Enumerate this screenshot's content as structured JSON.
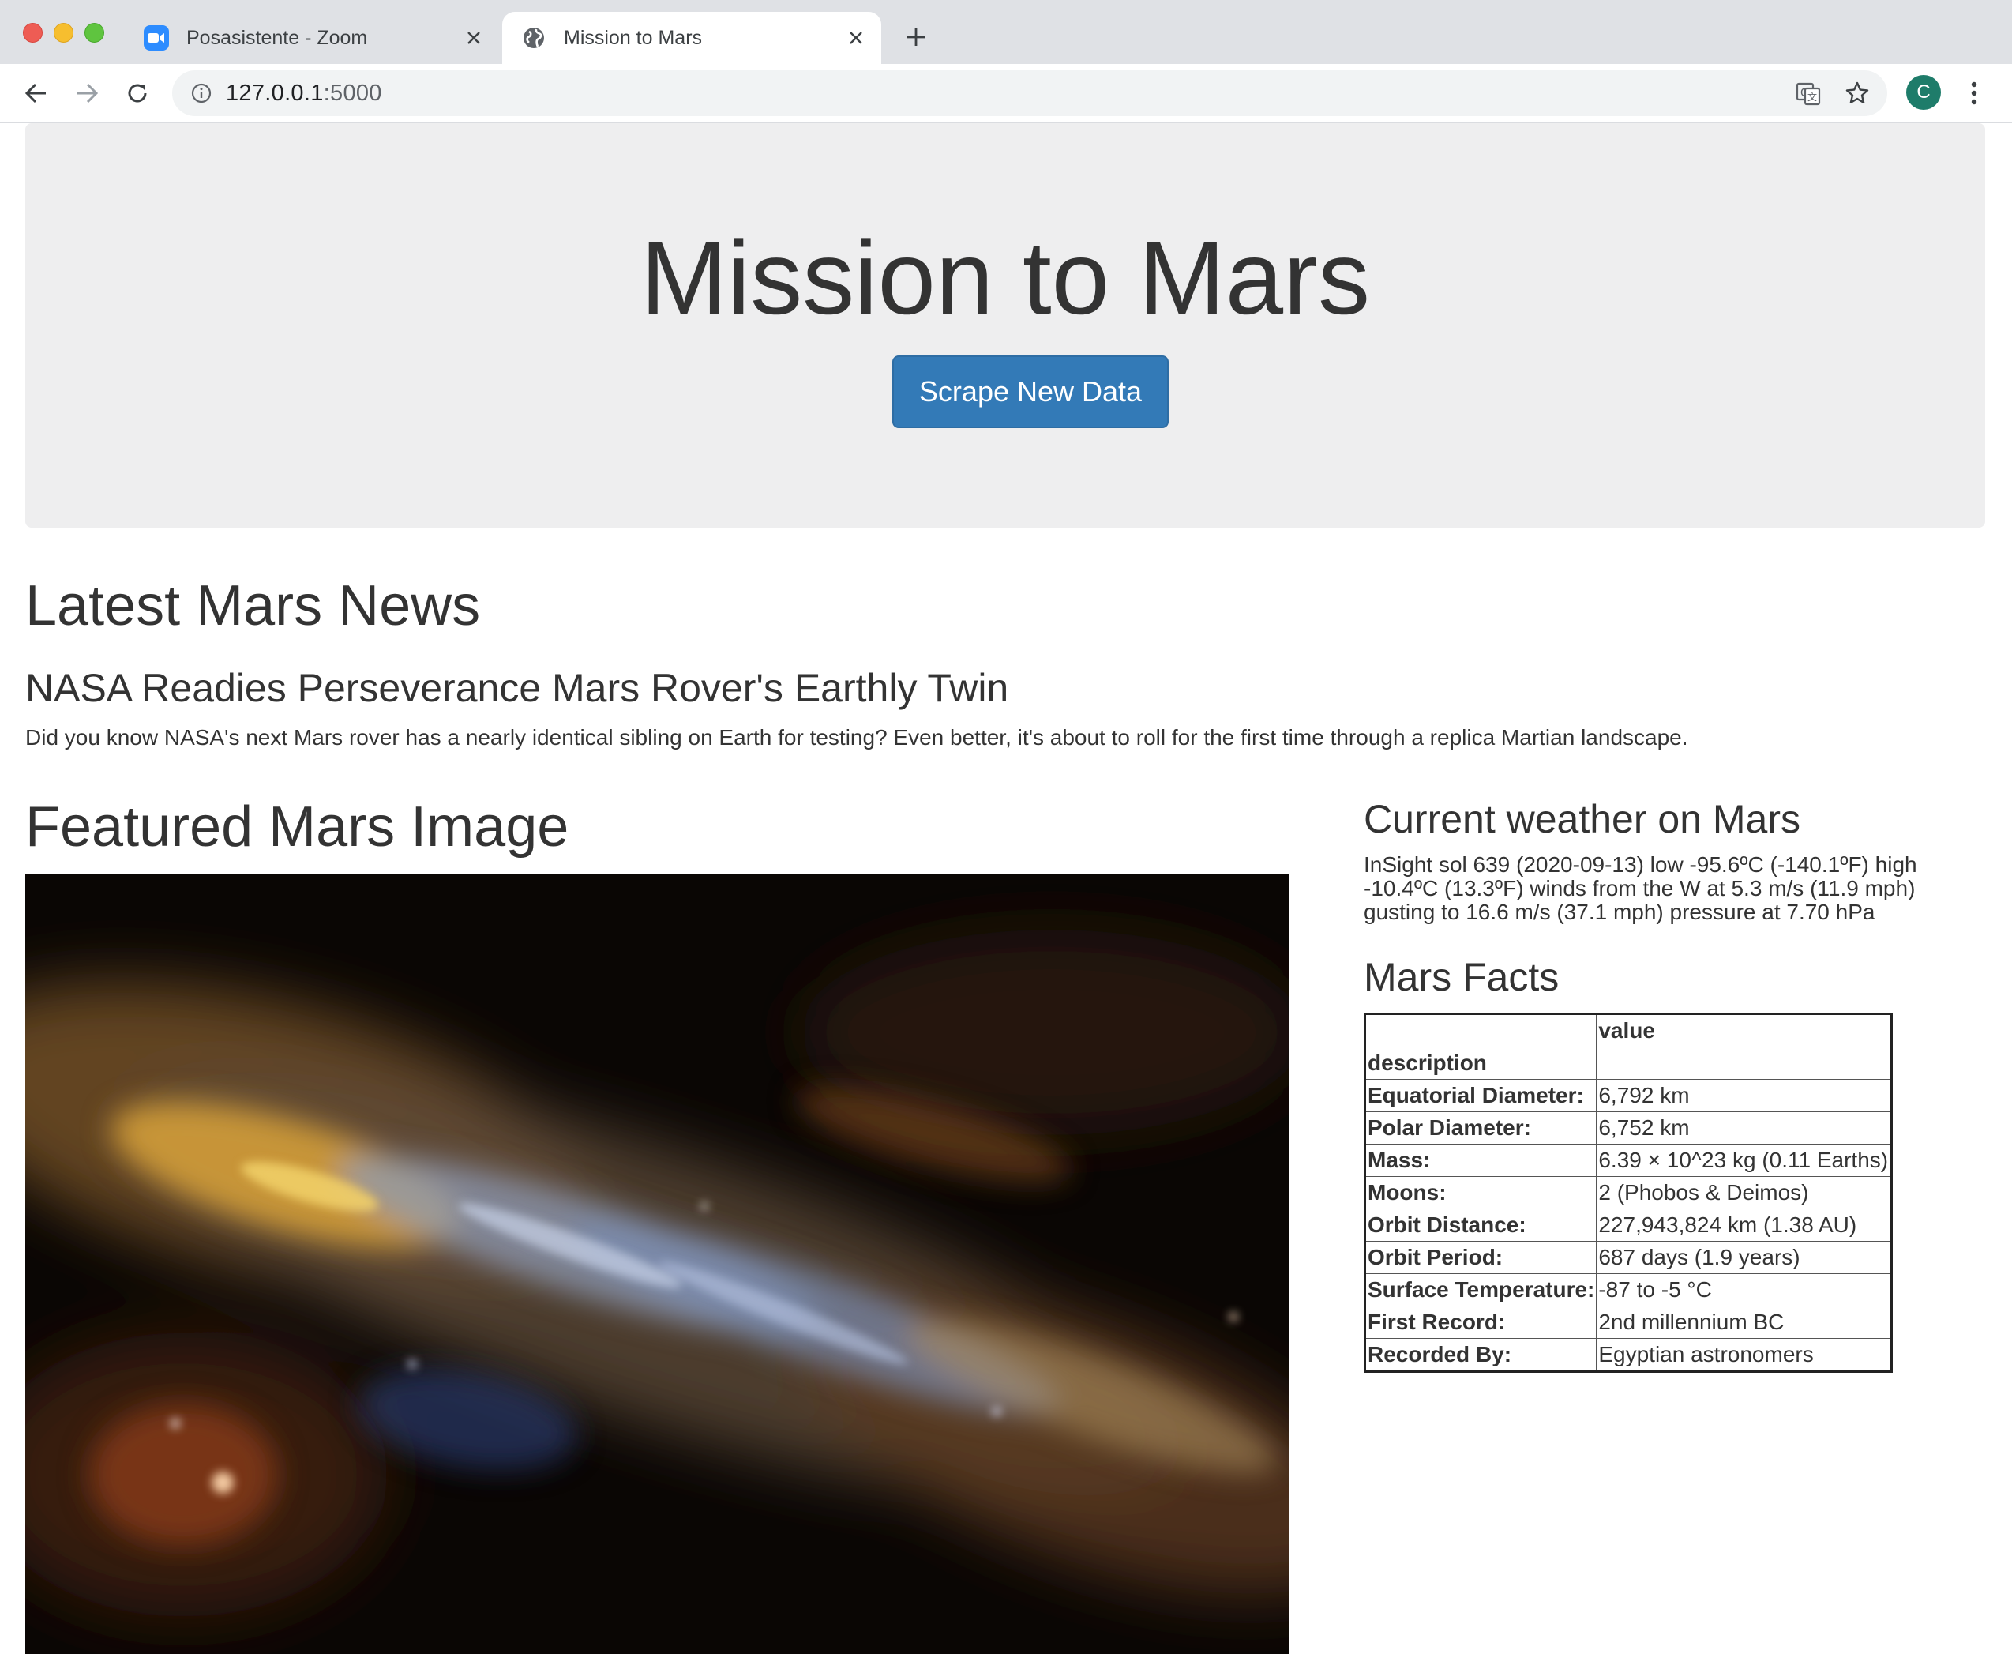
{
  "browser": {
    "tabs": [
      {
        "title": "Posasistente - Zoom",
        "active": false
      },
      {
        "title": "Mission to Mars",
        "active": true
      }
    ],
    "url_host": "127.0.0.1",
    "url_port": ":5000",
    "profile_initial": "C"
  },
  "page": {
    "title": "Mission to Mars",
    "scrape_button": "Scrape New Data",
    "news_heading": "Latest Mars News",
    "news_title": "NASA Readies Perseverance Mars Rover's Earthly Twin",
    "news_paragraph": "Did you know NASA's next Mars rover has a nearly identical sibling on Earth for testing? Even better, it's about to roll for the first time through a replica Martian landscape.",
    "featured_heading": "Featured Mars Image",
    "weather_heading": "Current weather on Mars",
    "weather_text": "InSight sol 639 (2020-09-13) low -95.6ºC (-140.1ºF) high -10.4ºC (13.3ºF) winds from the W at 5.3 m/s (11.9 mph) gusting to 16.6 m/s (37.1 mph) pressure at 7.70 hPa",
    "facts_heading": "Mars Facts",
    "facts": {
      "header_blank": "",
      "header_value": "value",
      "index_label": "description",
      "rows": [
        {
          "label": "Equatorial Diameter:",
          "value": "6,792 km"
        },
        {
          "label": "Polar Diameter:",
          "value": "6,752 km"
        },
        {
          "label": "Mass:",
          "value": "6.39 × 10^23 kg (0.11 Earths)"
        },
        {
          "label": "Moons:",
          "value": "2 (Phobos & Deimos)"
        },
        {
          "label": "Orbit Distance:",
          "value": "227,943,824 km (1.38 AU)"
        },
        {
          "label": "Orbit Period:",
          "value": "687 days (1.9 years)"
        },
        {
          "label": "Surface Temperature:",
          "value": "-87 to -5 °C"
        },
        {
          "label": "First Record:",
          "value": "2nd millennium BC"
        },
        {
          "label": "Recorded By:",
          "value": "Egyptian astronomers"
        }
      ]
    }
  },
  "colors": {
    "button": "#337ab7",
    "jumbotron": "#eeeeef",
    "text": "#333333"
  }
}
